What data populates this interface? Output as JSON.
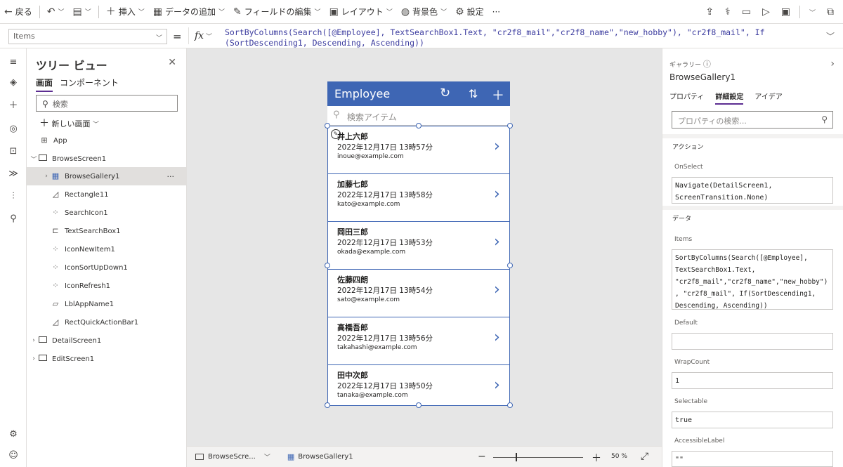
{
  "toolbar": {
    "back": "戻る",
    "insert": "挿入",
    "add_data": "データの追加",
    "edit_fields": "フィールドの編集",
    "layout": "レイアウト",
    "bg_color": "背景色",
    "settings": "設定",
    "more": "···"
  },
  "formula_bar": {
    "property": "Items",
    "eq": "=",
    "fx": "fx",
    "line1": "SortByColumns(Search([@Employee], TextSearchBox1.Text, \"cr2f8_mail\",\"cr2f8_name\",\"new_hobby\"), \"cr2f8_mail\", If",
    "line2": "(SortDescending1, Descending, Ascending))"
  },
  "tree": {
    "title": "ツリー ビュー",
    "tab_screens": "画面",
    "tab_components": "コンポーネント",
    "search_placeholder": "検索",
    "new_screen": "新しい画面",
    "nodes": [
      {
        "label": "App"
      },
      {
        "label": "BrowseScreen1"
      },
      {
        "label": "BrowseGallery1",
        "more": "···"
      },
      {
        "label": "Rectangle11"
      },
      {
        "label": "SearchIcon1"
      },
      {
        "label": "TextSearchBox1"
      },
      {
        "label": "IconNewItem1"
      },
      {
        "label": "IconSortUpDown1"
      },
      {
        "label": "IconRefresh1"
      },
      {
        "label": "LblAppName1"
      },
      {
        "label": "RectQuickActionBar1"
      },
      {
        "label": "DetailScreen1"
      },
      {
        "label": "EditScreen1"
      }
    ]
  },
  "app": {
    "header_title": "Employee",
    "search_placeholder": "検索アイテム",
    "records": [
      {
        "name": "井上六郎",
        "date": "2022年12月17日 13時57分",
        "mail": "inoue@example.com"
      },
      {
        "name": "加藤七郎",
        "date": "2022年12月17日 13時58分",
        "mail": "kato@example.com"
      },
      {
        "name": "岡田三郎",
        "date": "2022年12月17日 13時53分",
        "mail": "okada@example.com"
      },
      {
        "name": "佐藤四朗",
        "date": "2022年12月17日 13時54分",
        "mail": "sato@example.com"
      },
      {
        "name": "高橋吾郎",
        "date": "2022年12月17日 13時56分",
        "mail": "takahashi@example.com"
      },
      {
        "name": "田中次郎",
        "date": "2022年12月17日 13時50分",
        "mail": "tanaka@example.com"
      }
    ]
  },
  "status": {
    "screen": "BrowseScre...",
    "control": "BrowseGallery1",
    "zoom": "50",
    "zoom_unit": "%"
  },
  "props": {
    "type": "ギャラリー",
    "name": "BrowseGallery1",
    "tab_props": "プロパティ",
    "tab_advanced": "詳細設定",
    "tab_ideas": "アイデア",
    "search_placeholder": "プロパティの検索...",
    "sec_action": "アクション",
    "onselect_label": "OnSelect",
    "onselect_l1": "Navigate(DetailScreen1,",
    "onselect_l2": "ScreenTransition.None)",
    "sec_data": "データ",
    "items_label": "Items",
    "items_l1": "SortByColumns(Search([@Employee],",
    "items_l2": "TextSearchBox1.Text,",
    "items_l3": "\"cr2f8_mail\",\"cr2f8_name\",\"new_hobby\")",
    "items_l4": ", \"cr2f8_mail\", If(SortDescending1,",
    "items_l5": "Descending, Ascending))",
    "default_label": "Default",
    "default_value": "",
    "wrapcount_label": "WrapCount",
    "wrapcount_value": "1",
    "selectable_label": "Selectable",
    "selectable_value": "true",
    "accessible_label": "AccessibleLabel",
    "accessible_value": "\"\""
  },
  "colors": {
    "header": "#3e66b4",
    "accent": "#5c2d91"
  }
}
